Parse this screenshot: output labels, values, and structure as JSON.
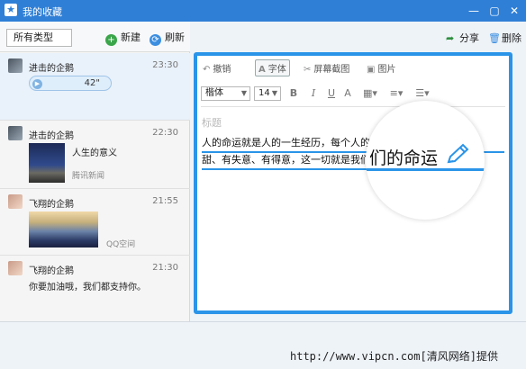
{
  "window": {
    "title": "我的收藏",
    "app_icon": "star-icon"
  },
  "left_toolbar": {
    "type_filter": "所有类型",
    "new_label": "新建",
    "refresh_label": "刷新"
  },
  "items": [
    {
      "user": "进击的企鹅",
      "time": "23:30",
      "type": "voice",
      "duration": "42\""
    },
    {
      "user": "进击的企鹅",
      "time": "22:30",
      "type": "news",
      "title": "人生的意义",
      "source": "腾讯新闻"
    },
    {
      "user": "飞翔的企鹅",
      "time": "21:55",
      "type": "image",
      "source": "QQ空间"
    },
    {
      "user": "飞翔的企鹅",
      "time": "21:30",
      "type": "text",
      "message": "你要加油哦，我们都支持你。"
    }
  ],
  "right_toolbar": {
    "share_label": "分享",
    "delete_label": "删除"
  },
  "editor": {
    "undo_label": "撤销",
    "font_label": "字体",
    "screenshot_label": "屏幕截图",
    "image_label": "图片",
    "font_family": "楷体",
    "font_size": "14",
    "title_placeholder": "标题",
    "line1": "人的命运就是人的一生经历，每个人的命运都不相同，有苦，有",
    "line2": "甜、有失意、有得意，这一切就是我们的命运",
    "magnified_text": "们的命运"
  },
  "watermark": "http://www.vipcn.com[清风网络]提供",
  "colors": {
    "titlebar": "#2f7fd6",
    "accent": "#2a94e8"
  }
}
